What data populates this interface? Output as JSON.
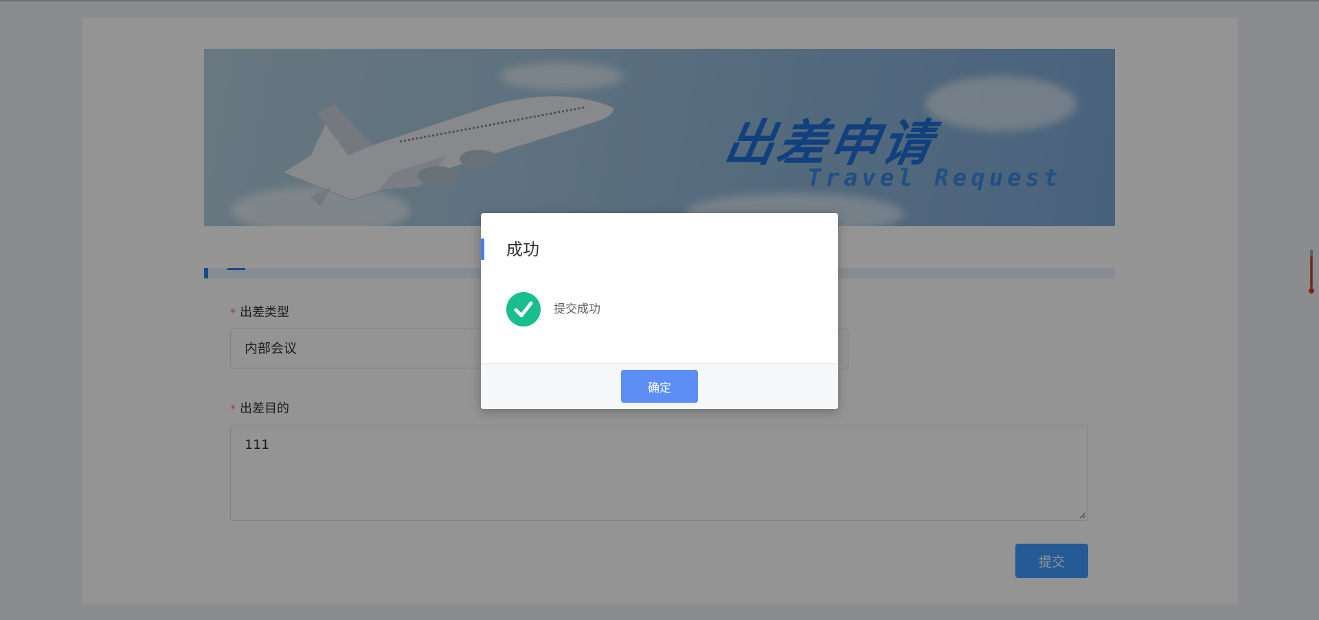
{
  "banner": {
    "title_cn": "出差申请",
    "title_en": "Travel Request"
  },
  "form": {
    "trip_type": {
      "label": "出差类型",
      "required_mark": "*",
      "value": "内部会议"
    },
    "trip_purpose": {
      "label": "出差目的",
      "required_mark": "*",
      "value": "111"
    },
    "submit_label": "提交"
  },
  "dialog": {
    "title": "成功",
    "message": "提交成功",
    "confirm_label": "确定",
    "icon": "check-circle-icon"
  },
  "colors": {
    "primary": "#409eff",
    "dialog_button": "#5c8ef6",
    "success": "#19be8f",
    "required": "#f56c6c",
    "accent": "#2f7de1"
  }
}
